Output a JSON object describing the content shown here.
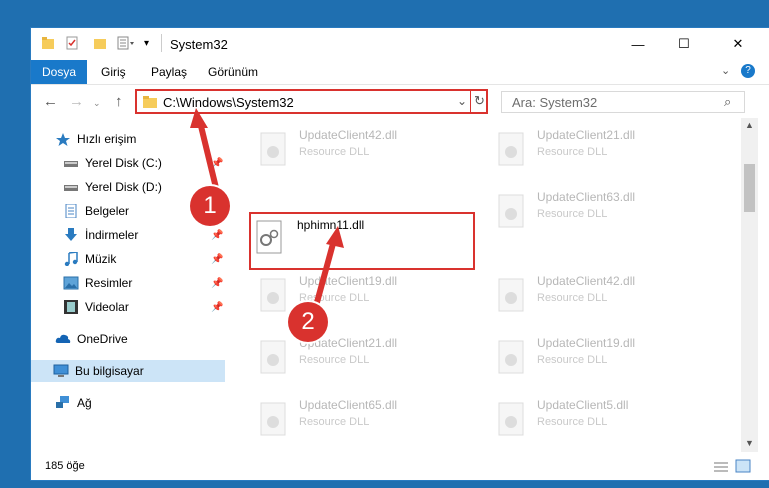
{
  "window": {
    "title": "System32",
    "minimize_glyph": "—",
    "maximize_glyph": "☐",
    "close_glyph": "✕"
  },
  "ribbon": {
    "tabs": [
      "Dosya",
      "Giriş",
      "Paylaş",
      "Görünüm"
    ]
  },
  "address": {
    "path": "C:\\Windows\\System32",
    "search_placeholder": "Ara: System32"
  },
  "sidebar": {
    "items": [
      {
        "label": "Hızlı erişim",
        "icon": "star-icon",
        "pinned": false
      },
      {
        "label": "Yerel Disk (C:)",
        "icon": "drive-icon",
        "pinned": true
      },
      {
        "label": "Yerel Disk (D:)",
        "icon": "drive-icon",
        "pinned": true
      },
      {
        "label": "Belgeler",
        "icon": "documents-icon",
        "pinned": true
      },
      {
        "label": "İndirmeler",
        "icon": "download-icon",
        "pinned": true
      },
      {
        "label": "Müzik",
        "icon": "music-icon",
        "pinned": true
      },
      {
        "label": "Resimler",
        "icon": "pictures-icon",
        "pinned": true
      },
      {
        "label": "Videolar",
        "icon": "videos-icon",
        "pinned": true
      },
      {
        "label": "OneDrive",
        "icon": "cloud-icon",
        "pinned": false
      },
      {
        "label": "Bu bilgisayar",
        "icon": "computer-icon",
        "pinned": false
      },
      {
        "label": "Ağ",
        "icon": "network-icon",
        "pinned": false
      }
    ]
  },
  "files": {
    "highlighted": {
      "name": "hphimn11.dll"
    },
    "col1": [
      {
        "name": "UpdateClient42.dll",
        "desc": "Resource DLL"
      },
      {
        "name": "UpdateClient19.dll",
        "desc": "Resource DLL"
      },
      {
        "name": "UpdateClient21.dll",
        "desc": "Resource DLL"
      },
      {
        "name": "UpdateClient65.dll",
        "desc": "Resource DLL"
      }
    ],
    "col2": [
      {
        "name": "UpdateClient21.dll",
        "desc": "Resource DLL"
      },
      {
        "name": "UpdateClient63.dll",
        "desc": "Resource DLL"
      },
      {
        "name": "UpdateClient42.dll",
        "desc": "Resource DLL"
      },
      {
        "name": "UpdateClient19.dll",
        "desc": "Resource DLL"
      },
      {
        "name": "UpdateClient5.dll",
        "desc": "Resource DLL"
      }
    ]
  },
  "status": {
    "count_text": "185 öğe"
  },
  "callouts": [
    "1",
    "2"
  ],
  "colors": {
    "accent": "#1979ca",
    "highlight": "#d9322e"
  }
}
